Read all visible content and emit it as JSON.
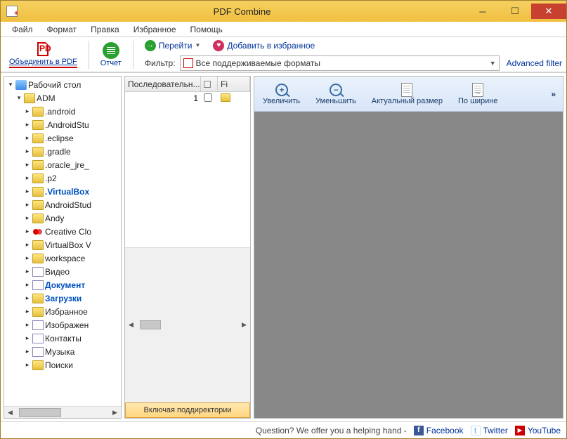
{
  "window": {
    "title": "PDF Combine"
  },
  "menu": {
    "items": [
      "Файл",
      "Формат",
      "Правка",
      "Избранное",
      "Помощь"
    ]
  },
  "toolbar": {
    "combine_label": "Объединить в PDF",
    "report_label": "Отчет",
    "goto_label": "Перейти",
    "favorite_label": "Добавить в избранное",
    "filter_label": "Фильтр:",
    "filter_value": "Все поддерживаемые форматы",
    "advanced_filter": "Advanced filter"
  },
  "tree": {
    "root": "Рабочий стол",
    "adm": "ADM",
    "items": [
      {
        "name": ".android",
        "icon": "folder",
        "bold": false
      },
      {
        "name": ".AndroidStu",
        "icon": "folder",
        "bold": false
      },
      {
        "name": ".eclipse",
        "icon": "folder",
        "bold": false
      },
      {
        "name": ".gradle",
        "icon": "folder",
        "bold": false
      },
      {
        "name": ".oracle_jre_",
        "icon": "folder",
        "bold": false
      },
      {
        "name": ".p2",
        "icon": "folder",
        "bold": false
      },
      {
        "name": ".VirtualBox",
        "icon": "folder",
        "bold": true
      },
      {
        "name": "AndroidStud",
        "icon": "folder",
        "bold": false
      },
      {
        "name": "Andy",
        "icon": "folder",
        "bold": false
      },
      {
        "name": "Creative Clo",
        "icon": "creative",
        "bold": false
      },
      {
        "name": "VirtualBox V",
        "icon": "folder",
        "bold": false
      },
      {
        "name": "workspace",
        "icon": "folder",
        "bold": false
      },
      {
        "name": "Видео",
        "icon": "doc",
        "bold": false
      },
      {
        "name": "Документ",
        "icon": "doc",
        "bold": true
      },
      {
        "name": "Загрузки",
        "icon": "folder",
        "bold": true
      },
      {
        "name": "Избранное",
        "icon": "folder",
        "bold": false
      },
      {
        "name": "Изображен",
        "icon": "doc",
        "bold": false
      },
      {
        "name": "Контакты",
        "icon": "doc",
        "bold": false
      },
      {
        "name": "Музыка",
        "icon": "doc",
        "bold": false
      },
      {
        "name": "Поиски",
        "icon": "folder",
        "bold": false
      }
    ]
  },
  "list": {
    "col1": "Последовательн...",
    "col2": "",
    "col3": "Fi",
    "row_num": "1",
    "subdir_button": "Включая поддиректории"
  },
  "preview": {
    "zoom_in": "Увеличить",
    "zoom_out": "Уменьшить",
    "actual": "Актуальный размер",
    "fit_width": "По ширине",
    "more": "»"
  },
  "status": {
    "question": "Question? We offer you a helping hand -",
    "facebook": "Facebook",
    "twitter": "Twitter",
    "youtube": "YouTube"
  }
}
